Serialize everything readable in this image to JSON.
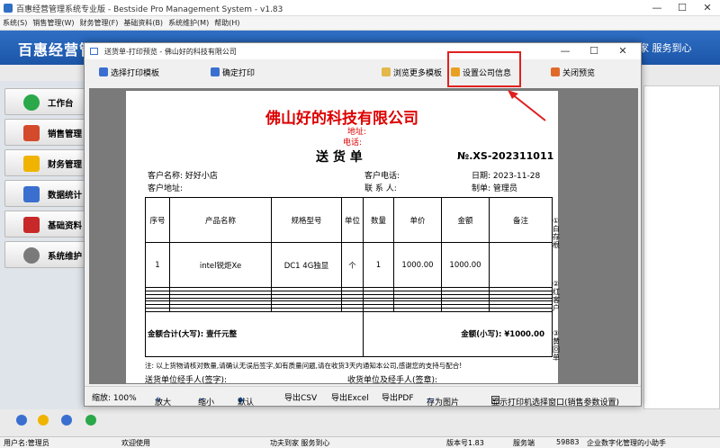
{
  "app": {
    "title": "百惠经营管理系统专业版 - Bestside Pro Management System - v1.83",
    "banner_title": "百惠经营管",
    "slogan": "家 服务到心"
  },
  "menu": [
    "系统(S)",
    "销售管理(W)",
    "财务管理(F)",
    "基础资料(B)",
    "系统维护(M)",
    "帮助(H)"
  ],
  "sidebar": [
    {
      "label": "工作台",
      "icon": "check-icon",
      "color": "#2aa84a"
    },
    {
      "label": "销售管理",
      "icon": "home-icon",
      "color": "#d44b2b"
    },
    {
      "label": "财务管理",
      "icon": "star-icon",
      "color": "#f0b400"
    },
    {
      "label": "数据统计",
      "icon": "bar-chart-icon",
      "color": "#3a6fd0"
    },
    {
      "label": "基础资料",
      "icon": "book-icon",
      "color": "#c82828"
    },
    {
      "label": "系统维护",
      "icon": "gear-icon",
      "color": "#7a7a7a"
    }
  ],
  "dialog": {
    "title": "送货单-打印预览 - 佛山好的科技有限公司",
    "toolbar": {
      "select_template": "选择打印模板",
      "confirm_print": "确定打印",
      "browse_templates": "浏览更多模板",
      "set_company": "设置公司信息",
      "close_preview": "关闭预览"
    },
    "footer": {
      "zoom": "缩放: 100%",
      "zoom_in": "放大",
      "zoom_out": "缩小",
      "default": "默认",
      "export_csv": "导出CSV",
      "export_excel": "导出Excel",
      "export_pdf": "导出PDF",
      "save_image": "存为图片",
      "show_printer": "显示打印机选择窗口(销售参数设置)"
    }
  },
  "doc": {
    "company": "佛山好的科技有限公司",
    "address_label": "地址:",
    "phone_label": "电话:",
    "doc_title": "送 货 单",
    "doc_no": "№.XS-202311011",
    "customer_name": "客户名称: 好好小店",
    "customer_phone": "客户电话:",
    "date": "日期: 2023-11-28",
    "customer_addr": "客户地址:",
    "contact": "联 系 人:",
    "maker": "制单: 管理员",
    "columns": [
      "序号",
      "产品名称",
      "规格型号",
      "单位",
      "数量",
      "单价",
      "金额",
      "备注"
    ],
    "rows": [
      [
        "1",
        "intel锐炬Xe",
        "DC1 4G独显",
        "个",
        "1",
        "1000.00",
        "1000.00",
        ""
      ]
    ],
    "total_upper": "金额合计(大写): 壹仟元整",
    "total_lower": "金额(小写): ¥1000.00",
    "note": "注: 以上货物请核对数量,请确认无误后签字,如有质量问题,请在收货3天内通知本公司,感谢您的支持与配合!",
    "sender_sign": "送货单位经手人(签字):",
    "receiver_sign": "收货单位及经手人(签章):",
    "side_notes": [
      "①白存根",
      "②红客户",
      "③黄回单"
    ]
  },
  "statusbar": {
    "user": "用户名:管理员",
    "welcome": "欢迎使用",
    "slogan": "功夫到家 服务到心",
    "version": "版本号1.83",
    "service": "服务端",
    "code": "59883",
    "helper": "企业数字化管理的小助手"
  }
}
